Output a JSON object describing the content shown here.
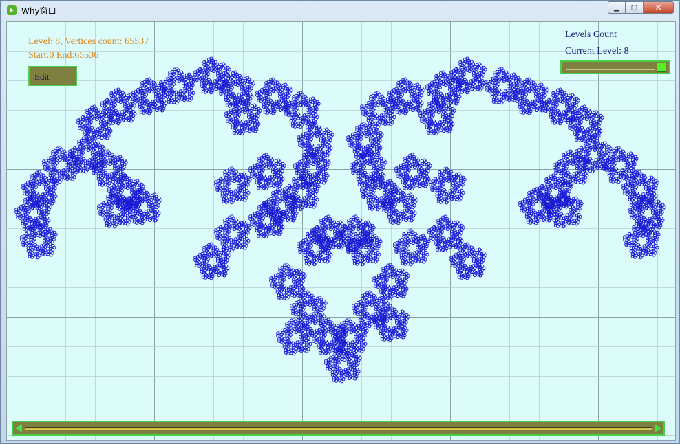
{
  "window": {
    "title": "Why窗口",
    "controls": {
      "minimize": "▁",
      "maximize": "▢",
      "close": "✕"
    }
  },
  "info": {
    "level_line": "Level: 8, Vertices count: 65537",
    "range_line": "Start:0 End:65536",
    "edit_label": "Edit"
  },
  "levels_panel": {
    "levels_count_label": "Levels Count",
    "current_level_label": "Current Level: 8"
  },
  "level_slider": {
    "value": 8,
    "max": 8
  },
  "colors": {
    "background": "#dcfcfc",
    "fractal": "#1a1ad4",
    "panel": "#7f8040",
    "panel_border": "#47d047",
    "info_text": "#d8861a",
    "label_text": "#1a1a7a"
  }
}
